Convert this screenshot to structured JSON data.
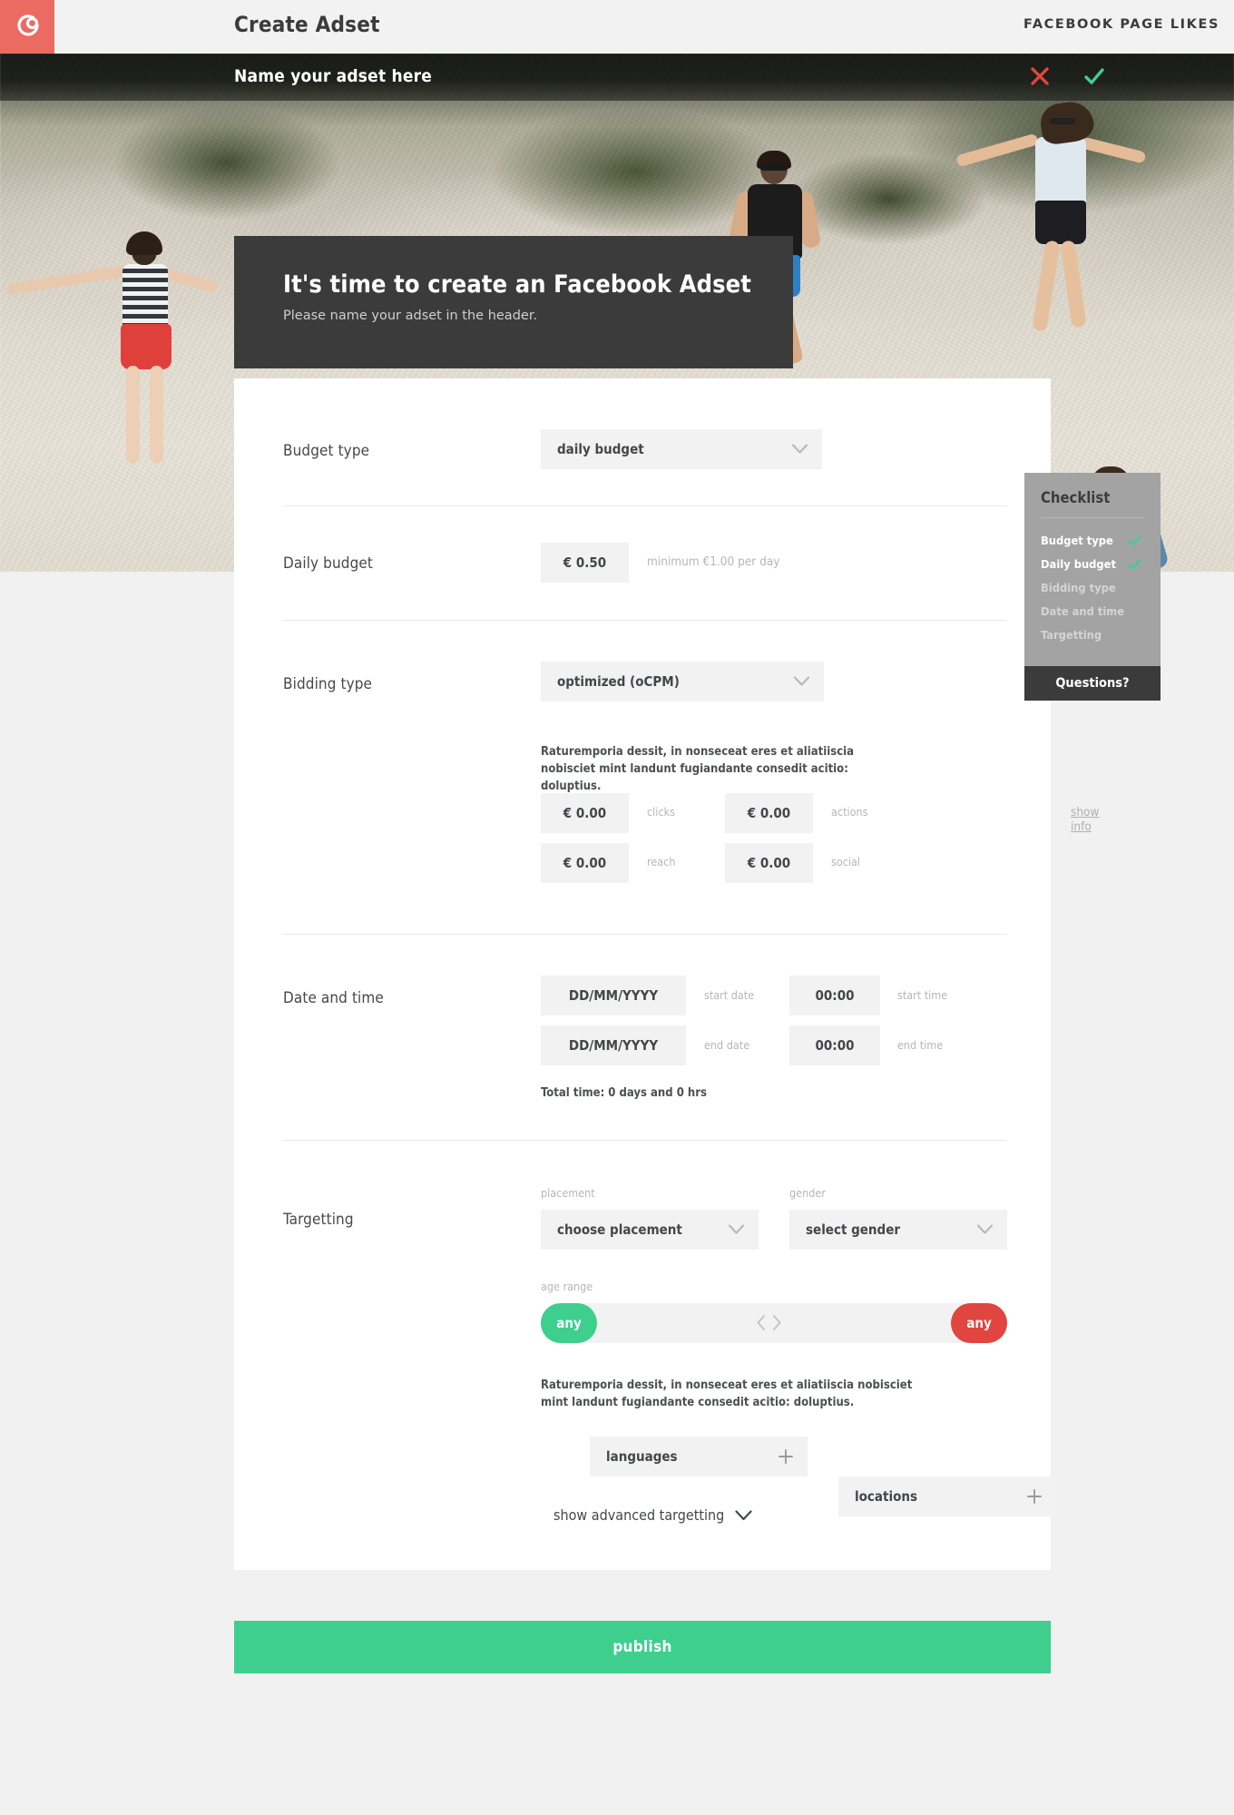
{
  "topbar": {
    "title": "Create Adset",
    "objective": "FACEBOOK PAGE LIKES",
    "logo_icon": "app-logo-icon"
  },
  "namebar": {
    "placeholder": "Name your adset here",
    "value": "",
    "cancel_icon": "close-x-icon",
    "confirm_icon": "checkmark-icon"
  },
  "intro": {
    "title": "It's time to create an Facebook Adset",
    "subtitle": "Please name your adset in the header."
  },
  "checklist": {
    "title": "Checklist",
    "items": [
      {
        "label": "Budget type",
        "done": true
      },
      {
        "label": "Daily budget",
        "done": true
      },
      {
        "label": "Bidding type",
        "done": false
      },
      {
        "label": "Date and time",
        "done": false
      },
      {
        "label": "Targetting",
        "done": false
      }
    ],
    "questions_label": "Questions?",
    "check_icon": "checkmark-icon",
    "done_color": "#3ecf8e"
  },
  "form": {
    "budget_type": {
      "label": "Budget type",
      "value": "daily budget",
      "chevron_icon": "chevron-down-icon",
      "show_info": "show info"
    },
    "daily_budget": {
      "label": "Daily budget",
      "value": "€ 0.50",
      "hint": "minimum €1.00 per day"
    },
    "bidding_type": {
      "label": "Bidding type",
      "value": "optimized (oCPM)",
      "chevron_icon": "chevron-down-icon",
      "description": "Raturemporia dessit, in nonseceat eres et aliatiiscia nobisciet mint landunt fugiandante consedit acitio: doluptius.",
      "bids": [
        {
          "value": "€ 0.00",
          "label": "clicks"
        },
        {
          "value": "€ 0.00",
          "label": "actions"
        },
        {
          "value": "€ 0.00",
          "label": "reach"
        },
        {
          "value": "€ 0.00",
          "label": "social"
        }
      ]
    },
    "date_time": {
      "label": "Date and time",
      "start_date": {
        "value": "DD/MM/YYYY",
        "label": "start date"
      },
      "start_time": {
        "value": "00:00",
        "label": "start time"
      },
      "end_date": {
        "value": "DD/MM/YYYY",
        "label": "end date"
      },
      "end_time": {
        "value": "00:00",
        "label": "end time"
      },
      "total": "Total time: 0 days and 0 hrs"
    },
    "targetting": {
      "label": "Targetting",
      "placement": {
        "label": "placement",
        "value": "choose placement",
        "chevron_icon": "chevron-down-icon"
      },
      "gender": {
        "label": "gender",
        "value": "select gender",
        "chevron_icon": "chevron-down-icon"
      },
      "age_range": {
        "label": "age range",
        "min_value": "any",
        "max_value": "any",
        "min_color": "#3ecf8e",
        "max_color": "#e0453f",
        "left_arrow_icon": "chevron-left-icon",
        "right_arrow_icon": "chevron-right-icon"
      },
      "description": "Raturemporia dessit, in nonseceat eres et aliatiiscia nobisciet mint landunt fugiandante consedit acitio: doluptius.",
      "languages": {
        "value": "languages",
        "plus_icon": "plus-icon"
      },
      "locations": {
        "value": "locations",
        "plus_icon": "plus-icon"
      }
    },
    "advanced_toggle": {
      "label": "show advanced targetting",
      "chevron_icon": "chevron-down-icon"
    }
  },
  "publish": {
    "label": "publish",
    "color": "#3ecf8e"
  }
}
